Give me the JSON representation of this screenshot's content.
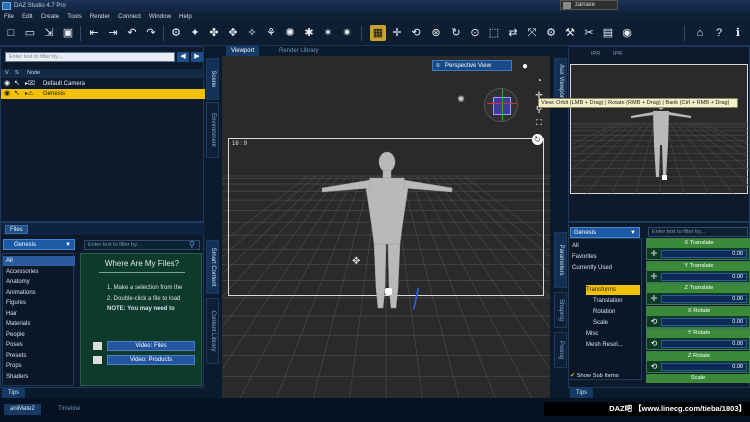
{
  "window": {
    "title": "DAZ Studio 4.7 Pro",
    "user": "zarraxe"
  },
  "menu": [
    "File",
    "Edit",
    "Create",
    "Tools",
    "Render",
    "Connect",
    "Window",
    "Help"
  ],
  "scene": {
    "filter_placeholder": "Enter text to filter by...",
    "columns": {
      "v": "V",
      "s": "S",
      "node": "Node"
    },
    "nodes": [
      {
        "label": "Default Camera",
        "selected": false
      },
      {
        "label": "Genesis",
        "selected": true
      }
    ],
    "side_tabs": [
      "Scene",
      "Environment"
    ]
  },
  "content": {
    "tab": "Files",
    "dropdown": "Genesis",
    "filter_placeholder": "Enter text to filter by...",
    "categories": [
      "All",
      "Accessories",
      "Anatomy",
      "Animations",
      "Figures",
      "Hair",
      "Materials",
      "People",
      "Poses",
      "Presets",
      "Props",
      "Shaders"
    ],
    "help_title": "Where Are My Files?",
    "help_lines": [
      "1.  Make a selection from the",
      "2.  Double-click a file to load",
      "NOTE: You may need to"
    ],
    "video_files": "Video:  Files",
    "video_products": "Video:  Products",
    "side_tabs": [
      "Smart Content",
      "Content Library"
    ]
  },
  "viewport": {
    "tabs": [
      "Viewport",
      "Render Library"
    ],
    "camera": "Perspective View",
    "aspect": "16 : 9"
  },
  "aux": {
    "side_tabs": [
      "Aux Viewport"
    ],
    "tooltip": "View: Orbit (LMB + Drag) | Rotate (RMB + Drag) | Bank (Ctrl + RMB + Drag)",
    "mini_tabs": [
      "IPR",
      "IPR"
    ]
  },
  "parameters": {
    "dropdown": "Genesis",
    "filter_placeholder": "Enter text to filter by...",
    "side_tabs": [
      "Parameters",
      "Shaping",
      "Posing"
    ],
    "tree": [
      {
        "label": "All",
        "hl": false,
        "indent": 0
      },
      {
        "label": "Favorites",
        "hl": false,
        "indent": 0
      },
      {
        "label": "Currently Used",
        "hl": false,
        "indent": 0
      },
      {
        "label": "Transforms",
        "hl": true,
        "indent": 2
      },
      {
        "label": "Translation",
        "hl": false,
        "indent": 3
      },
      {
        "label": "Rotation",
        "hl": false,
        "indent": 3
      },
      {
        "label": "Scale",
        "hl": false,
        "indent": 3
      },
      {
        "label": "Misc",
        "hl": false,
        "indent": 2
      },
      {
        "label": "Mesh Resol...",
        "hl": false,
        "indent": 2
      }
    ],
    "show_sub_items": "Show Sub Items",
    "groups": [
      {
        "label": "X Translate",
        "value": "0.00"
      },
      {
        "label": "Y Translate",
        "value": "0.00"
      },
      {
        "label": "Z Translate",
        "value": "0.00"
      },
      {
        "label": "X Rotate",
        "value": "0.00"
      },
      {
        "label": "Y Rotate",
        "value": "0.00"
      },
      {
        "label": "Z Rotate",
        "value": "0.00"
      }
    ],
    "scale_label": "Scale"
  },
  "bottom": {
    "tips_left": "Tips",
    "tips_right": "Tips",
    "tabs": [
      "aniMate2",
      "Timeline"
    ],
    "watermark": "DAZ吧  【www.linecg.com/tieba/1803】"
  },
  "colors": {
    "accent": "#f2c200",
    "panel": "#0c1a2b",
    "viewport": "#2a2a2a",
    "param_green": "#3a8a3a"
  }
}
